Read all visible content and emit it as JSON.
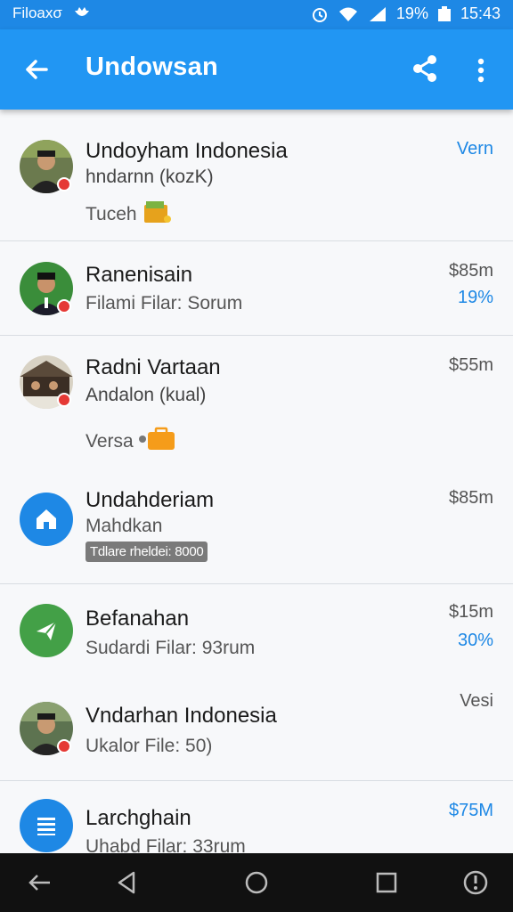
{
  "status_bar": {
    "carrier": "Filoaxσ",
    "battery_pct": "19%",
    "time": "15:43"
  },
  "app_bar": {
    "title": "Undowsan"
  },
  "colors": {
    "primary": "#2196f3",
    "status": "#1e88e5",
    "accent_green": "#43a047",
    "badge_red": "#e53935",
    "folder_orange": "#f59c1a"
  },
  "items": [
    {
      "name": "Undoyham Indonesia",
      "subtitle": "hndarnn (kozK)",
      "extra": "Tuceh",
      "extra_icon": "folder-icon",
      "price": "Vern"
    },
    {
      "name": "Ranenisain",
      "subtitle": "Filami Filar: Sorum",
      "price": "$85m",
      "percent": "19%"
    },
    {
      "name": "Radni Vartaan",
      "subtitle": "Andalon (kual)",
      "extra": "Versa",
      "extra_icon": "briefcase-icon",
      "price": "$55m"
    },
    {
      "name": "Undahderiam",
      "subtitle": "Mahdkan",
      "tag": "Tdlare rheldei: 8000",
      "icon": "home-icon",
      "price": "$85m"
    },
    {
      "name": "Befanahan",
      "subtitle": "Sudardi Filar: 93rum",
      "icon": "send-icon",
      "price": "$15m",
      "percent": "30%"
    },
    {
      "name": "Vndarhan Indonesia",
      "subtitle": "Ukalor File: 50)",
      "price": "Vesi"
    },
    {
      "name": "Larchghain",
      "subtitle": "Uhabd Filar: 33rum",
      "icon": "document-icon",
      "price": "$75M"
    }
  ]
}
